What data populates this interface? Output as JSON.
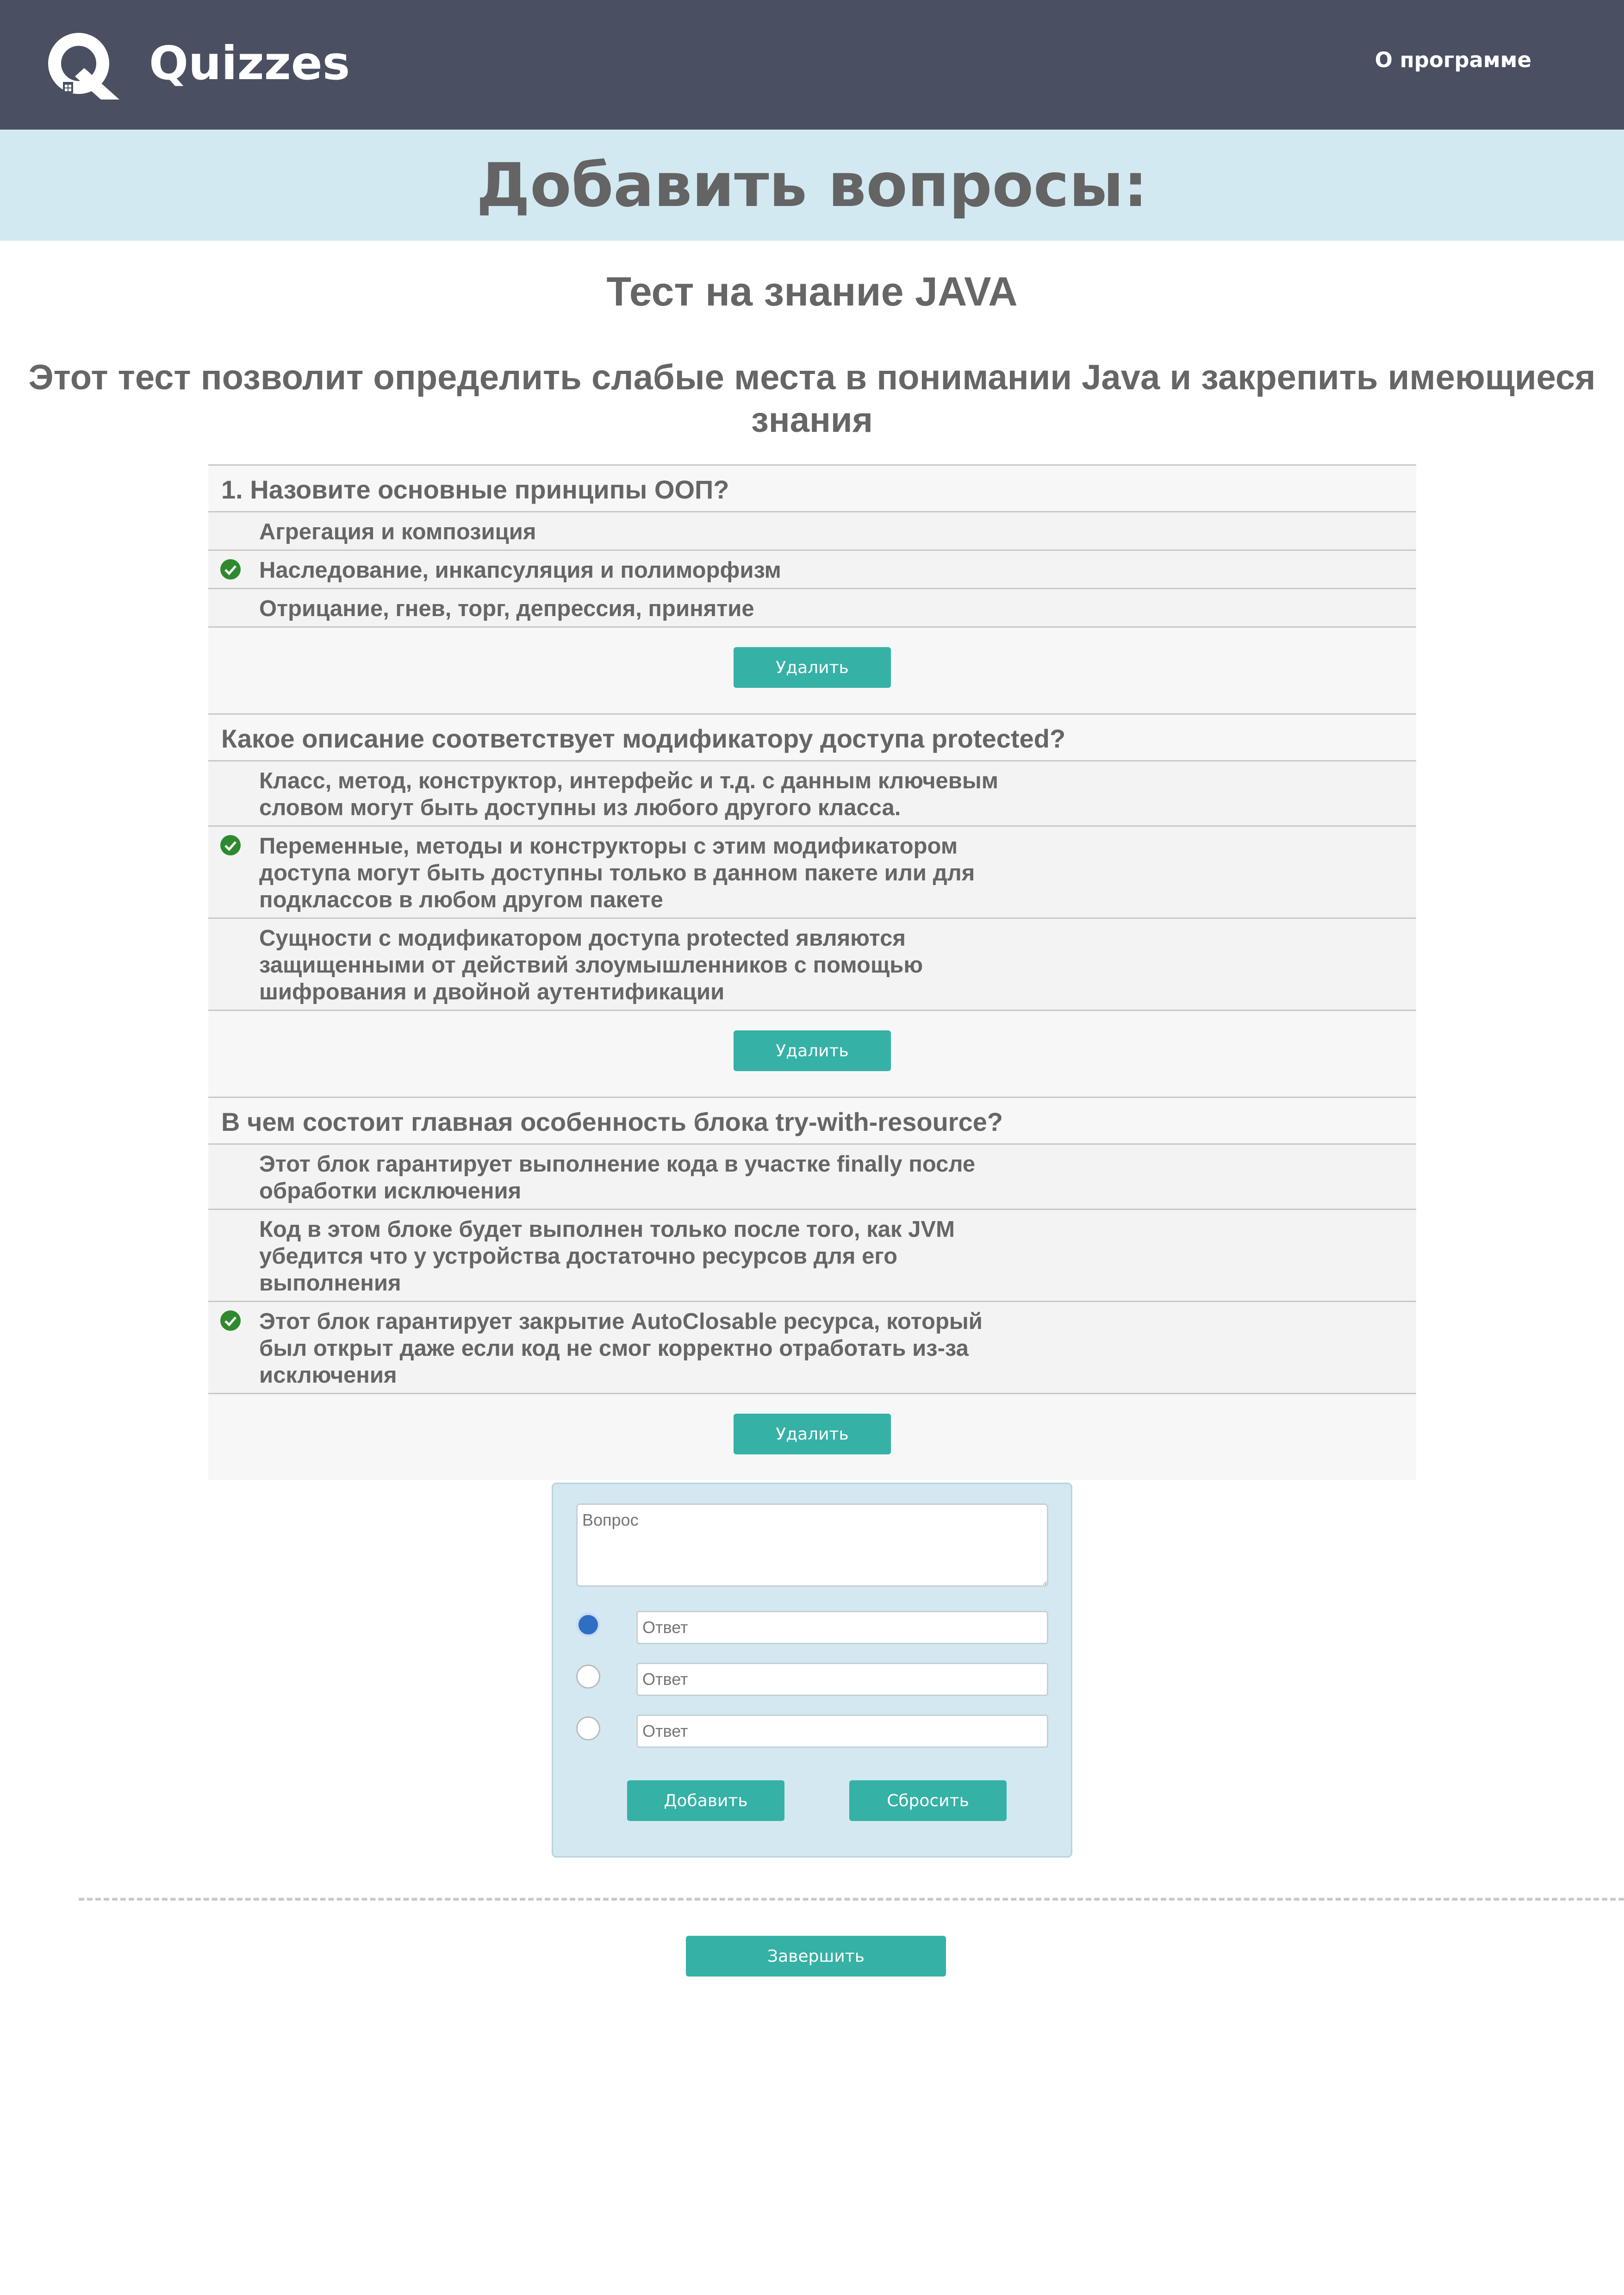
{
  "header": {
    "brand": "Quizzes",
    "logo_icon": "quizzes-logo-icon",
    "nav_about": "О программе",
    "colors": {
      "bar": "#4a5061",
      "banner": "#d2e9f1",
      "accent": "#36b1a6"
    }
  },
  "banner": {
    "title": "Добавить вопросы:"
  },
  "test": {
    "title": "Тест на знание JAVA",
    "description": "Этот тест позволит определить слабые места в понимании Java и закрепить имеющиеся знания"
  },
  "questions": [
    {
      "title": "1. Назовите основные принципы ООП?",
      "answers": [
        {
          "text": "Агрегация и композиция",
          "correct": false
        },
        {
          "text": "Наследование, инкапсуляция и полиморфизм",
          "correct": true
        },
        {
          "text": "Отрицание, гнев, торг, депрессия, принятие",
          "correct": false
        }
      ],
      "delete_label": "Удалить"
    },
    {
      "title": "Какое описание соответствует модификатору доступа protected?",
      "answers": [
        {
          "text": "Класс, метод, конструктор, интерфейс и т.д. с данным ключевым словом могут быть доступны из любого другого класса.",
          "correct": false
        },
        {
          "text": "Переменные, методы и конструкторы с этим модификатором доступа могут быть доступны только в данном пакете или для подклассов в любом другом пакете",
          "correct": true
        },
        {
          "text": "Сущности с модификатором доступа protected являются защищенными от действий злоумышленников с помощью шифрования и двойной аутентификации",
          "correct": false
        }
      ],
      "delete_label": "Удалить"
    },
    {
      "title": "В чем состоит главная особенность блока try-with-resource?",
      "answers": [
        {
          "text": "Этот блок гарантирует выполнение кода в участке finally после обработки исключения",
          "correct": false
        },
        {
          "text": "Код в этом блоке будет выполнен только после того, как JVM убедится что у устройства достаточно ресурсов для его выполнения",
          "correct": false
        },
        {
          "text": "Этот блок гарантирует закрытие AutoClosable ресурса, который был открыт даже если код не смог корректно отработать из-за исключения",
          "correct": true
        }
      ],
      "delete_label": "Удалить"
    }
  ],
  "form": {
    "question_placeholder": "Вопрос",
    "answer_placeholders": [
      "Ответ",
      "Ответ",
      "Ответ"
    ],
    "selected_correct_index": 0,
    "add_label": "Добавить",
    "reset_label": "Сбросить"
  },
  "footer": {
    "finish_label": "Завершить"
  }
}
